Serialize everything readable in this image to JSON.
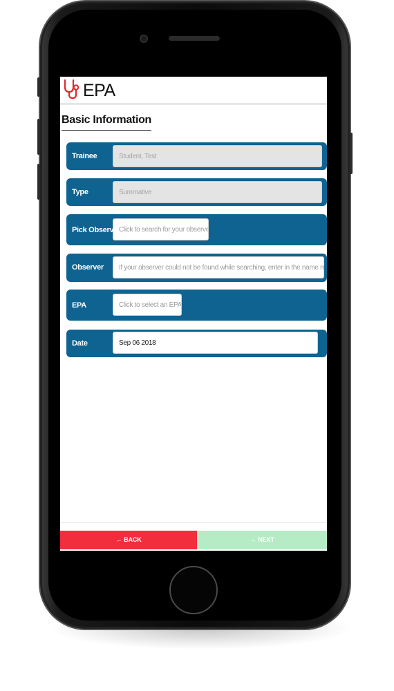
{
  "header": {
    "title": "EPA"
  },
  "section": {
    "title": "Basic Information"
  },
  "form": {
    "trainee": {
      "label": "Trainee",
      "value": "Student, Test"
    },
    "type": {
      "label": "Type",
      "value": "Summative"
    },
    "pick_observer": {
      "label": "Pick Observer",
      "placeholder": "Click to search for your observer"
    },
    "observer": {
      "label": "Observer",
      "placeholder": "If your observer could not be found while searching, enter in the name manually"
    },
    "epa": {
      "label": "EPA",
      "placeholder": "Click to select an EPA"
    },
    "date": {
      "label": "Date",
      "value": "Sep 06 2018"
    }
  },
  "nav": {
    "back_label": "BACK",
    "next_label": "NEXT",
    "back_icon": "arrow-left-icon",
    "next_icon": "arrow-right-icon"
  },
  "colors": {
    "primary": "#0e6390",
    "back": "#f22d3c",
    "next": "#b5ecc5",
    "logo": "#e3262f"
  }
}
